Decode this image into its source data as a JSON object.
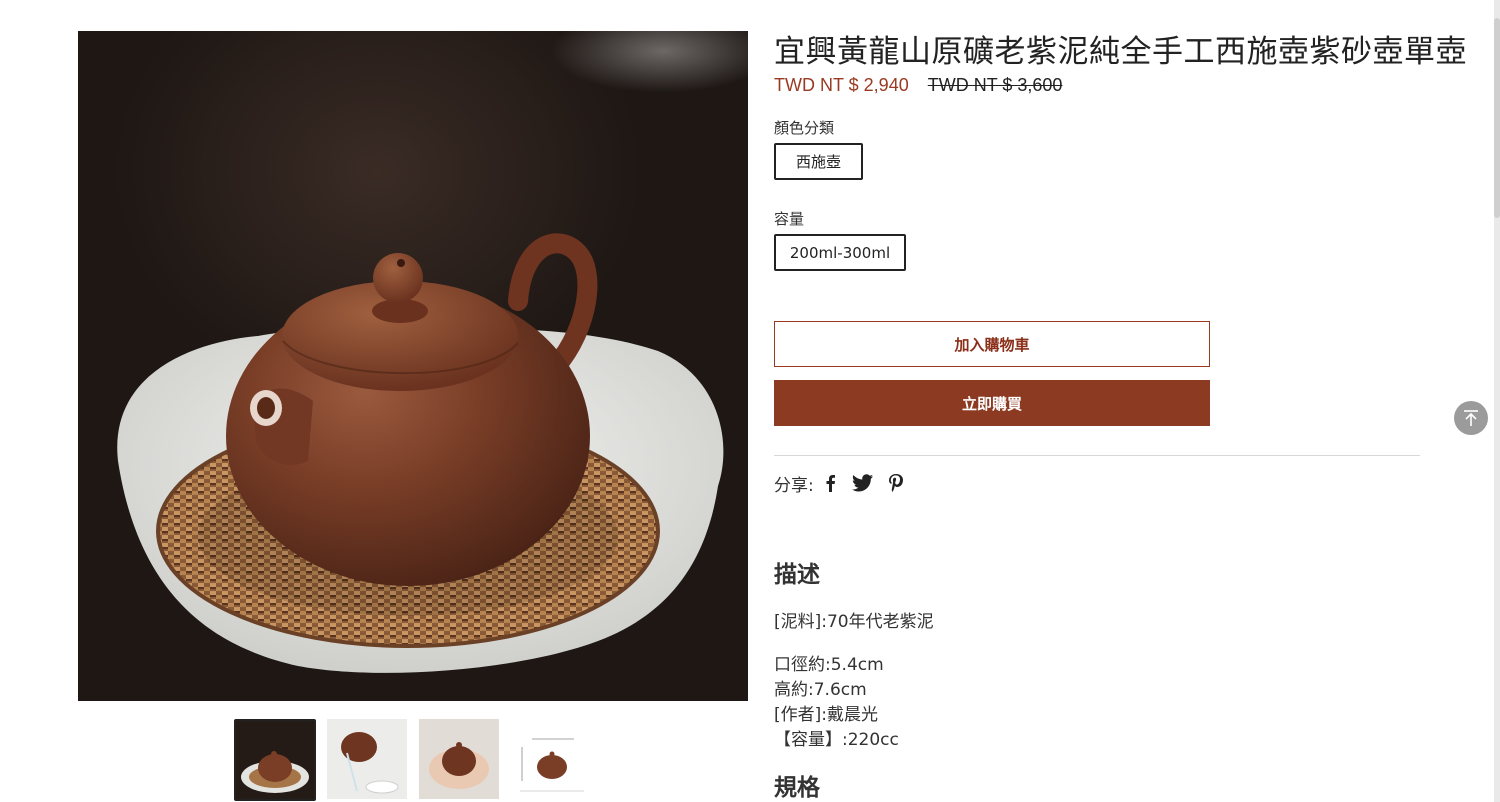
{
  "product": {
    "title": "宜興黃龍山原礦老紫泥純全手工西施壺紫砂壺單壺",
    "price_current": "TWD NT $ 2,940",
    "price_original": "TWD NT $ 3,600",
    "main_image_icon": "teapot-photo"
  },
  "options": {
    "color": {
      "label": "顏色分類",
      "selected": "西施壺"
    },
    "capacity": {
      "label": "容量",
      "selected": "200ml-300ml"
    }
  },
  "actions": {
    "add_to_cart": "加入購物車",
    "buy_now": "立即購買"
  },
  "share": {
    "label": "分享:",
    "icons": [
      "facebook-icon",
      "twitter-icon",
      "pinterest-icon"
    ]
  },
  "description": {
    "heading": "描述",
    "material": "[泥料]:70年代老紫泥",
    "lines": [
      "口徑約:5.4cm",
      "高約:7.6cm",
      "[作者]:戴晨光",
      "【容量】:220cc"
    ]
  },
  "specs": {
    "heading": "規格"
  },
  "thumbnails": [
    "teapot-on-tray",
    "teapot-pouring",
    "teapot-in-hands",
    "teapot-dimension-diagram"
  ],
  "colors": {
    "accent": "#8c3a22",
    "price": "#9a3a22",
    "clay": "#7a3e27"
  }
}
